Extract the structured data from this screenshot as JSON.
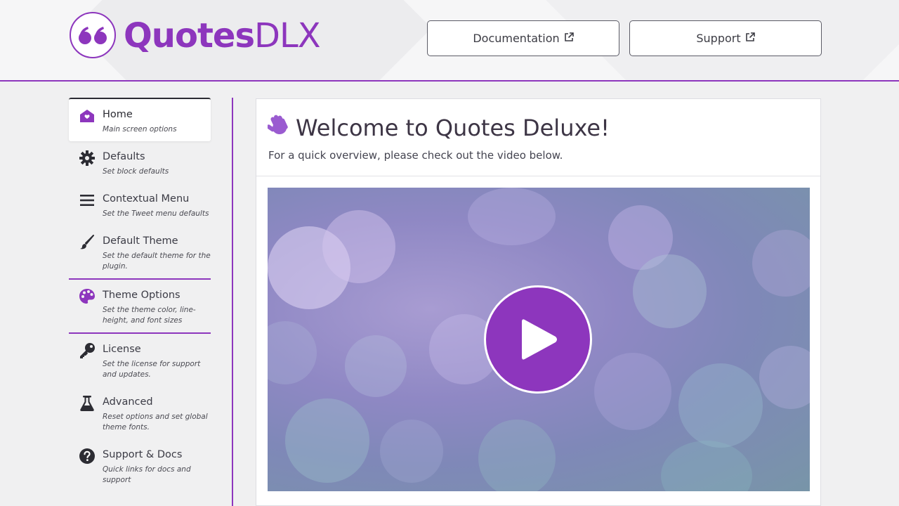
{
  "brand": {
    "name_bold": "Quotes",
    "name_light": "DLX",
    "accent": "#8d36bd"
  },
  "header": {
    "buttons": [
      {
        "label": "Documentation",
        "icon": "external-link-icon"
      },
      {
        "label": "Support",
        "icon": "external-link-icon"
      }
    ]
  },
  "sidebar": {
    "items": [
      {
        "label": "Home",
        "sub": "Main screen options",
        "icon": "home-icon",
        "active": true
      },
      {
        "label": "Defaults",
        "sub": "Set block defaults",
        "icon": "gear-icon"
      },
      {
        "label": "Contextual Menu",
        "sub": "Set the Tweet menu defaults",
        "icon": "menu-icon"
      },
      {
        "label": "Default Theme",
        "sub": "Set the default theme for the plugin.",
        "icon": "brush-icon"
      },
      {
        "label": "Theme Options",
        "sub": "Set the theme color, line-height, and font sizes",
        "icon": "palette-icon"
      },
      {
        "label": "License",
        "sub": "Set the license for support and updates.",
        "icon": "key-icon"
      },
      {
        "label": "Advanced",
        "sub": "Reset options and set global theme fonts.",
        "icon": "flask-icon"
      },
      {
        "label": "Support & Docs",
        "sub": "Quick links for docs and support",
        "icon": "question-icon"
      }
    ]
  },
  "main": {
    "title": "Welcome to Quotes Deluxe!",
    "title_icon": "waving-hand-icon",
    "intro": "For a quick overview, please check out the video below.",
    "video": {
      "play_icon": "play-icon"
    }
  }
}
